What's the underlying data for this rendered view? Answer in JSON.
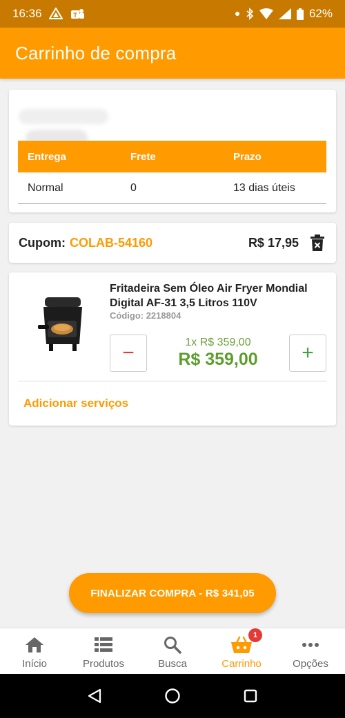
{
  "status_bar": {
    "time": "16:36",
    "battery": "62%"
  },
  "app_bar": {
    "title": "Carrinho de compra"
  },
  "shipping": {
    "headers": [
      "Entrega",
      "Frete",
      "Prazo"
    ],
    "row": {
      "entrega": "Normal",
      "frete": "0",
      "prazo": "13 dias úteis"
    }
  },
  "coupon": {
    "label": "Cupom:",
    "code": "COLAB-54160",
    "value": "R$ 17,95"
  },
  "product": {
    "name": "Fritadeira Sem Óleo Air Fryer Mondial Digital AF-31 3,5 Litros 110V",
    "code": "Código: 2218804",
    "unit_price": "1x R$ 359,00",
    "total_price": "R$ 359,00",
    "minus": "−",
    "plus": "+",
    "services_link": "Adicionar serviços"
  },
  "checkout": {
    "label": "FINALIZAR COMPRA - R$ 341,05"
  },
  "bottom_nav": {
    "items": [
      {
        "label": "Início",
        "icon": "home-icon"
      },
      {
        "label": "Produtos",
        "icon": "list-icon"
      },
      {
        "label": "Busca",
        "icon": "search-icon"
      },
      {
        "label": "Carrinho",
        "icon": "basket-icon",
        "active": true,
        "badge": "1"
      },
      {
        "label": "Opções",
        "icon": "more-icon"
      }
    ]
  },
  "colors": {
    "accent": "#ff9a00",
    "status_bar": "#c87a00",
    "price_green": "#5c9e2e",
    "minus_red": "#e53935"
  }
}
